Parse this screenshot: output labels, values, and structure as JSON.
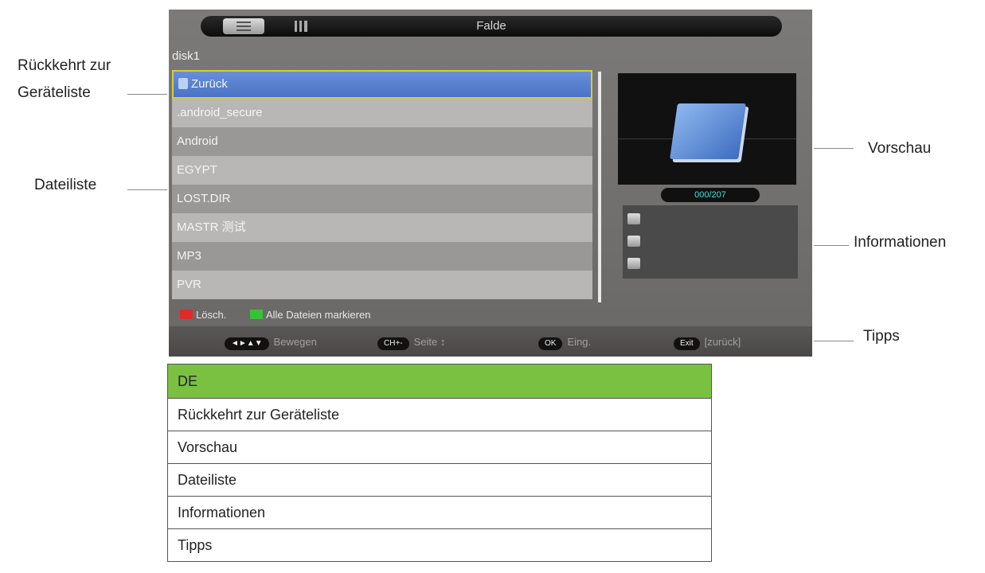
{
  "screen": {
    "folder_title": "Falde",
    "disk_label": "disk1",
    "files": [
      {
        "name": "Zurück",
        "selected": true
      },
      {
        "name": ".android_secure",
        "selected": false
      },
      {
        "name": "Android",
        "selected": false
      },
      {
        "name": "EGYPT",
        "selected": false
      },
      {
        "name": "LOST.DIR",
        "selected": false
      },
      {
        "name": "MASTR 测试",
        "selected": false
      },
      {
        "name": "MP3",
        "selected": false
      },
      {
        "name": "PVR",
        "selected": false
      }
    ],
    "size_text": "000/207",
    "color_keys": {
      "red": "Lösch.",
      "green": "Alle Dateien markieren"
    },
    "hints": [
      {
        "key": "◄►▲▼",
        "label": "Bewegen"
      },
      {
        "key": "CH+-",
        "label": "Seite ↕"
      },
      {
        "key": "OK",
        "label": "Eing."
      },
      {
        "key": "Exit",
        "label": "[zurück]"
      }
    ]
  },
  "callouts": {
    "back_line1": "Rückkehrt zur",
    "back_line2": "Geräteliste",
    "preview": "Vorschau",
    "file_list": "Dateiliste",
    "info": "Informationen",
    "tips": "Tipps"
  },
  "table": {
    "header": "DE",
    "rows": [
      "Rückkehrt zur Geräteliste",
      "Vorschau",
      "Dateiliste",
      "Informationen",
      "Tipps"
    ]
  },
  "colors": {
    "table_header": "#7ac142",
    "selection": "#4a73c4",
    "selection_border": "#d6cc3a"
  }
}
